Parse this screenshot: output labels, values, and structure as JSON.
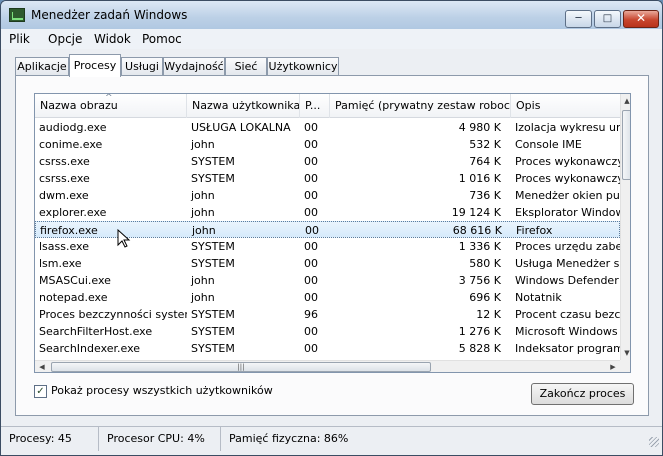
{
  "window": {
    "title": "Menedżer zadań Windows"
  },
  "menu": [
    "Plik",
    "Opcje",
    "Widok",
    "Pomoc"
  ],
  "tabs": [
    {
      "label": "Aplikacje",
      "active": false
    },
    {
      "label": "Procesy",
      "active": true
    },
    {
      "label": "Usługi",
      "active": false
    },
    {
      "label": "Wydajność",
      "active": false
    },
    {
      "label": "Sieć",
      "active": false
    },
    {
      "label": "Użytkownicy",
      "active": false
    }
  ],
  "table": {
    "columns": [
      "Nazwa obrazu",
      "Nazwa użytkownika",
      "P...",
      "Pamięć (prywatny zestaw roboczy)",
      "Opis"
    ],
    "sort_column": "Nazwa obrazu",
    "rows": [
      {
        "name": "audiodg.exe",
        "user": "USŁUGA LOKALNA",
        "cpu": "00",
        "mem": "4 980 K",
        "desc": "Izolacja wykresu urządzeń"
      },
      {
        "name": "conime.exe",
        "user": "john",
        "cpu": "00",
        "mem": "532 K",
        "desc": "Console IME"
      },
      {
        "name": "csrss.exe",
        "user": "SYSTEM",
        "cpu": "00",
        "mem": "764 K",
        "desc": "Proces wykonawczy klient"
      },
      {
        "name": "csrss.exe",
        "user": "SYSTEM",
        "cpu": "00",
        "mem": "1 016 K",
        "desc": "Proces wykonawczy klient"
      },
      {
        "name": "dwm.exe",
        "user": "john",
        "cpu": "00",
        "mem": "736 K",
        "desc": "Menedżer okien pulpitu"
      },
      {
        "name": "explorer.exe",
        "user": "john",
        "cpu": "00",
        "mem": "19 124 K",
        "desc": "Eksplorator Windows"
      },
      {
        "name": "firefox.exe",
        "user": "john",
        "cpu": "00",
        "mem": "68 616 K",
        "desc": "Firefox",
        "selected": true
      },
      {
        "name": "lsass.exe",
        "user": "SYSTEM",
        "cpu": "00",
        "mem": "1 336 K",
        "desc": "Proces urzędu zabezpiecz"
      },
      {
        "name": "lsm.exe",
        "user": "SYSTEM",
        "cpu": "00",
        "mem": "580 K",
        "desc": "Usługa Menedżer sesji"
      },
      {
        "name": "MSASCui.exe",
        "user": "john",
        "cpu": "00",
        "mem": "3 756 K",
        "desc": "Windows Defender User"
      },
      {
        "name": "notepad.exe",
        "user": "john",
        "cpu": "00",
        "mem": "696 K",
        "desc": "Notatnik"
      },
      {
        "name": "Proces bezczynności systemu",
        "user": "SYSTEM",
        "cpu": "96",
        "mem": "12 K",
        "desc": "Procent czasu bezczynn"
      },
      {
        "name": "SearchFilterHost.exe",
        "user": "SYSTEM",
        "cpu": "00",
        "mem": "1 276 K",
        "desc": "Microsoft Windows Sear"
      },
      {
        "name": "SearchIndexer.exe",
        "user": "SYSTEM",
        "cpu": "00",
        "mem": "5 828 K",
        "desc": "Indeksator programu"
      }
    ]
  },
  "show_all": {
    "label": "Pokaż procesy wszystkich użytkowników",
    "checked": true
  },
  "end_process_label": "Zakończ proces",
  "status": {
    "processes": "Procesy: 45",
    "cpu": "Procesor CPU: 4%",
    "memory": "Pamięć fizyczna: 86%"
  },
  "icons": {
    "app": "task-manager-icon",
    "sort": "sort-ascending-icon",
    "check": "checkmark-icon",
    "grip": "resize-grip-icon",
    "cursor": "mouse-pointer-icon"
  }
}
